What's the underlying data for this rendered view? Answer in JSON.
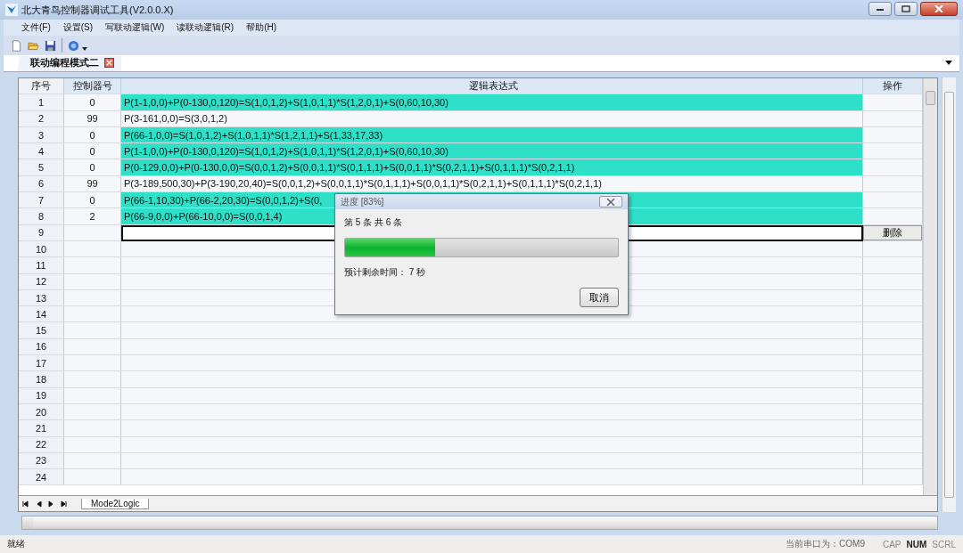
{
  "window": {
    "title": "北大青鸟控制器调试工具(V2.0.0.X)"
  },
  "menu": [
    "文件(F)",
    "设置(S)",
    "写联动逻辑(W)",
    "读联动逻辑(R)",
    "帮助(H)"
  ],
  "doc_tabs": [
    {
      "label": "联动编程模式二",
      "selected": true
    }
  ],
  "table": {
    "columns": [
      "序号",
      "控制器号",
      "逻辑表达式",
      "操作"
    ],
    "rows": [
      {
        "index": "1",
        "controller": "0",
        "expression": "P(1-1,0,0)+P(0-130,0,120)=S(1,0,1,2)+S(1,0,1,1)*S(1,2,0,1)+S(0,60,10,30)",
        "highlighted": true,
        "editing": false
      },
      {
        "index": "2",
        "controller": "99",
        "expression": "P(3-161,0,0)=S(3,0,1,2)",
        "highlighted": false,
        "editing": false
      },
      {
        "index": "3",
        "controller": "0",
        "expression": "P(66-1,0,0)=S(1,0,1,2)+S(1,0,1,1)*S(1,2,1,1)+S(1,33,17,33)",
        "highlighted": true,
        "editing": false
      },
      {
        "index": "4",
        "controller": "0",
        "expression": "P(1-1,0,0)+P(0-130,0,120)=S(1,0,1,2)+S(1,0,1,1)*S(1,2,0,1)+S(0,60,10,30)",
        "highlighted": true,
        "editing": false
      },
      {
        "index": "5",
        "controller": "0",
        "expression": "P(0-129,0,0)+P(0-130,0,0)=S(0,0,1,2)+S(0,0,1,1)*S(0,1,1,1)+S(0,0,1,1)*S(0,2,1,1)+S(0,1,1,1)*S(0,2,1,1)",
        "highlighted": true,
        "editing": false
      },
      {
        "index": "6",
        "controller": "99",
        "expression": "P(3-189,500,30)+P(3-190,20,40)=S(0,0,1,2)+S(0,0,1,1)*S(0,1,1,1)+S(0,0,1,1)*S(0,2,1,1)+S(0,1,1,1)*S(0,2,1,1)",
        "highlighted": false,
        "editing": false
      },
      {
        "index": "7",
        "controller": "0",
        "expression": "P(66-1,10,30)+P(66-2,20,30)=S(0,0,1,2)+S(0,",
        "highlighted": true,
        "editing": false
      },
      {
        "index": "8",
        "controller": "2",
        "expression": "P(66-9,0,0)+P(66-10,0,0)=S(0,0,1,4)",
        "highlighted": true,
        "editing": false
      },
      {
        "index": "9",
        "action": "删除",
        "highlighted": false,
        "editing": true
      },
      {
        "index": "10"
      },
      {
        "index": "11"
      },
      {
        "index": "12"
      },
      {
        "index": "13"
      },
      {
        "index": "14"
      },
      {
        "index": "15"
      },
      {
        "index": "16"
      },
      {
        "index": "17"
      },
      {
        "index": "18"
      },
      {
        "index": "19"
      },
      {
        "index": "20"
      },
      {
        "index": "21"
      },
      {
        "index": "22"
      },
      {
        "index": "23"
      },
      {
        "index": "24"
      }
    ]
  },
  "sheet_tabs": [
    {
      "label": "Mode2Logic",
      "selected": true
    }
  ],
  "dialog": {
    "title": "进度 [83%]",
    "message": "第 5 条 共 6 条",
    "level": 0.33,
    "remaining": "预计剩余时间：  7 秒",
    "button": "取消"
  },
  "status_bar": {
    "text": "就绪",
    "port": "当前串口为：COM9",
    "indicators": [
      {
        "label": "CAP",
        "on": false
      },
      {
        "label": "NUM",
        "on": true
      },
      {
        "label": "SCRL",
        "on": false
      }
    ]
  }
}
